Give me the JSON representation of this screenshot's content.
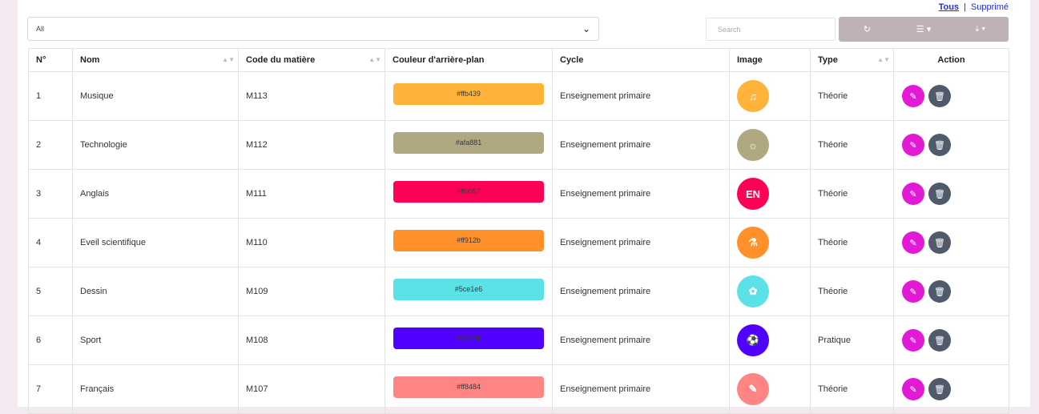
{
  "toplinks": {
    "all": "Tous",
    "sep": "|",
    "deleted": "Supprimé"
  },
  "filter": {
    "value": "All",
    "chevron_icon": "chevron-down-icon"
  },
  "search": {
    "placeholder": "Search"
  },
  "toolbar": {
    "refresh_icon": "refresh-icon",
    "columns_icon": "list-columns-icon",
    "export_icon": "download-icon"
  },
  "table": {
    "headers": {
      "num": "N°",
      "name": "Nom",
      "code": "Code du matière",
      "color": "Couleur d'arrière-plan",
      "cycle": "Cycle",
      "image": "Image",
      "type": "Type",
      "action": "Action"
    },
    "rows": [
      {
        "num": "1",
        "name": "Musique",
        "code": "M113",
        "color": "#ffb439",
        "cycle": "Enseignement primaire",
        "type": "Théorie",
        "icon": "music-book-icon"
      },
      {
        "num": "2",
        "name": "Technologie",
        "code": "M112",
        "color": "#afa881",
        "cycle": "Enseignement primaire",
        "type": "Théorie",
        "icon": "lightbulb-icon"
      },
      {
        "num": "3",
        "name": "Anglais",
        "code": "M111",
        "color": "#ff0057",
        "cycle": "Enseignement primaire",
        "type": "Théorie",
        "icon": "en-flag-icon"
      },
      {
        "num": "4",
        "name": "Eveil scientifique",
        "code": "M110",
        "color": "#ff912b",
        "cycle": "Enseignement primaire",
        "type": "Théorie",
        "icon": "science-icon"
      },
      {
        "num": "5",
        "name": "Dessin",
        "code": "M109",
        "color": "#5ce1e6",
        "cycle": "Enseignement primaire",
        "type": "Théorie",
        "icon": "palette-icon"
      },
      {
        "num": "6",
        "name": "Sport",
        "code": "M108",
        "color": "#5000ff",
        "cycle": "Enseignement primaire",
        "type": "Pratique",
        "icon": "sport-icon"
      },
      {
        "num": "7",
        "name": "Français",
        "code": "M107",
        "color": "#ff8484",
        "cycle": "Enseignement primaire",
        "type": "Théorie",
        "icon": "french-book-icon"
      }
    ]
  }
}
